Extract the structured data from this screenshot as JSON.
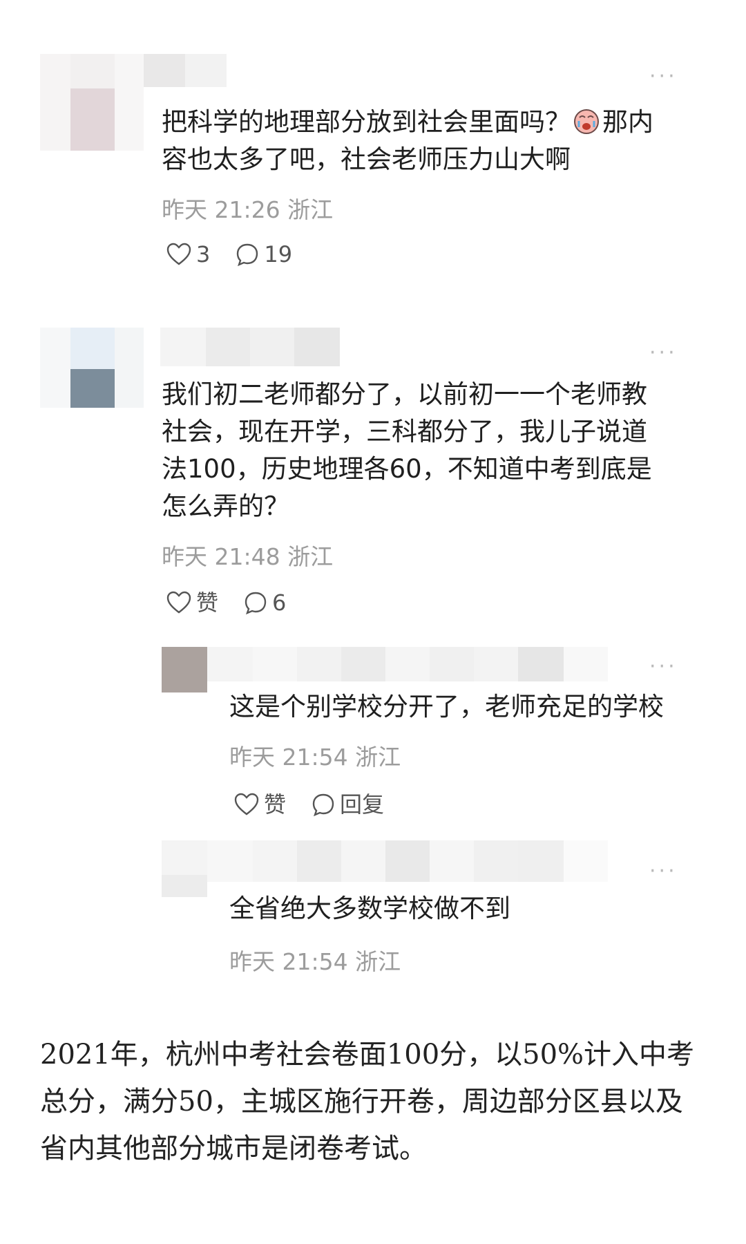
{
  "comments": [
    {
      "text_lines": [
        "把科学的地理部分放到社会里面吗？",
        "容也太多了吧，社会老师压力山大啊"
      ],
      "emoji_then": "那内",
      "time": "昨天 21:26",
      "location": "浙江",
      "like_label": "3",
      "reply_label": "19"
    },
    {
      "text_lines": [
        "我们初二老师都分了，以前初一一个老师教",
        "社会，现在开学，三科都分了，我儿子说道",
        "法100，历史地理各60，不知道中考到底是",
        "怎么弄的？"
      ],
      "time": "昨天 21:48",
      "location": "浙江",
      "like_label": "赞",
      "reply_label": "6"
    },
    {
      "text_lines": [
        "这是个别学校分开了，老师充足的学校"
      ],
      "time": "昨天 21:54",
      "location": "浙江",
      "like_label": "赞",
      "reply_label": "回复"
    },
    {
      "text_lines": [
        "全省绝大多数学校做不到"
      ],
      "time": "昨天 21:54",
      "location": "浙江"
    }
  ],
  "more_label": "···",
  "emoji_icon": "crying-face-emoji",
  "article": {
    "lines": [
      "2021年，杭州中考社会卷面100分，以50%计入中考",
      "总分，满分50，主城区施行开卷，周边部分区县以及",
      "省内其他部分城市是闭卷考试。"
    ]
  },
  "colors": {
    "text": "#1f1f1f",
    "meta": "#9c9c9c",
    "icon": "#555555"
  }
}
